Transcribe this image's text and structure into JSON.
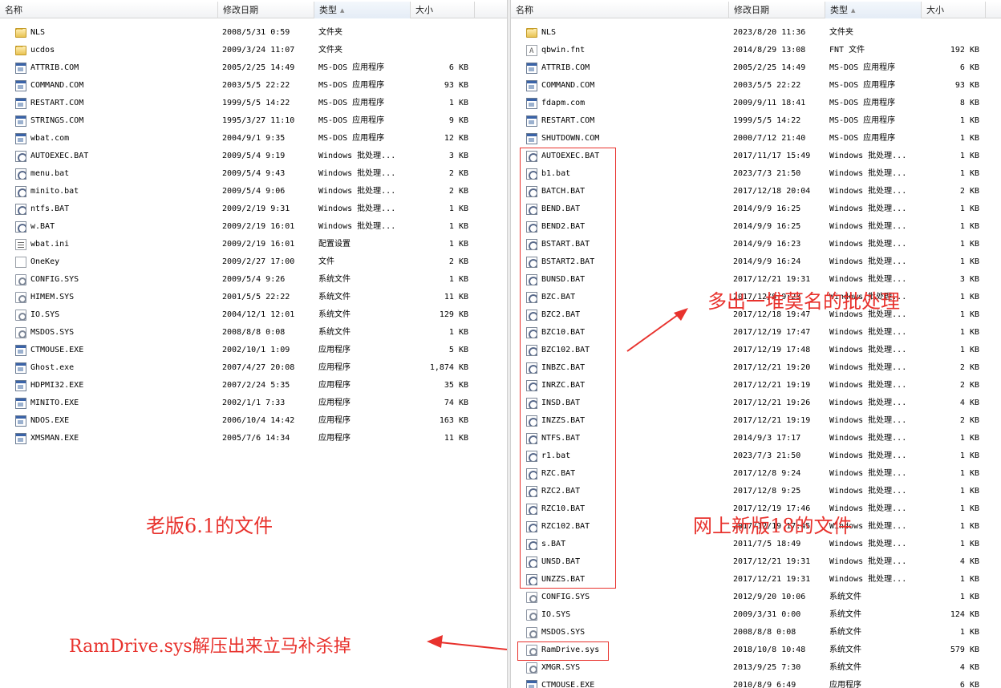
{
  "columns": {
    "name": "名称",
    "date": "修改日期",
    "type": "类型",
    "size": "大小"
  },
  "left": {
    "rows": [
      {
        "icon": "folder",
        "name": "NLS",
        "date": "2008/5/31 0:59",
        "type": "文件夹",
        "size": ""
      },
      {
        "icon": "folder",
        "name": "ucdos",
        "date": "2009/3/24 11:07",
        "type": "文件夹",
        "size": ""
      },
      {
        "icon": "app",
        "name": "ATTRIB.COM",
        "date": "2005/2/25 14:49",
        "type": "MS-DOS 应用程序",
        "size": "6 KB"
      },
      {
        "icon": "app",
        "name": "COMMAND.COM",
        "date": "2003/5/5 22:22",
        "type": "MS-DOS 应用程序",
        "size": "93 KB"
      },
      {
        "icon": "app",
        "name": "RESTART.COM",
        "date": "1999/5/5 14:22",
        "type": "MS-DOS 应用程序",
        "size": "1 KB"
      },
      {
        "icon": "app",
        "name": "STRINGS.COM",
        "date": "1995/3/27 11:10",
        "type": "MS-DOS 应用程序",
        "size": "9 KB"
      },
      {
        "icon": "app",
        "name": "wbat.com",
        "date": "2004/9/1 9:35",
        "type": "MS-DOS 应用程序",
        "size": "12 KB"
      },
      {
        "icon": "bat",
        "name": "AUTOEXEC.BAT",
        "date": "2009/5/4 9:19",
        "type": "Windows 批处理...",
        "size": "3 KB"
      },
      {
        "icon": "bat",
        "name": "menu.bat",
        "date": "2009/5/4 9:43",
        "type": "Windows 批处理...",
        "size": "2 KB"
      },
      {
        "icon": "bat",
        "name": "minito.bat",
        "date": "2009/5/4 9:06",
        "type": "Windows 批处理...",
        "size": "2 KB"
      },
      {
        "icon": "bat",
        "name": "ntfs.BAT",
        "date": "2009/2/19 9:31",
        "type": "Windows 批处理...",
        "size": "1 KB"
      },
      {
        "icon": "bat",
        "name": "w.BAT",
        "date": "2009/2/19 16:01",
        "type": "Windows 批处理...",
        "size": "1 KB"
      },
      {
        "icon": "ini",
        "name": "wbat.ini",
        "date": "2009/2/19 16:01",
        "type": "配置设置",
        "size": "1 KB"
      },
      {
        "icon": "doc",
        "name": "OneKey",
        "date": "2009/2/27 17:00",
        "type": "文件",
        "size": "2 KB"
      },
      {
        "icon": "sys",
        "name": "CONFIG.SYS",
        "date": "2009/5/4 9:26",
        "type": "系统文件",
        "size": "1 KB"
      },
      {
        "icon": "sys",
        "name": "HIMEM.SYS",
        "date": "2001/5/5 22:22",
        "type": "系统文件",
        "size": "11 KB"
      },
      {
        "icon": "sys",
        "name": "IO.SYS",
        "date": "2004/12/1 12:01",
        "type": "系统文件",
        "size": "129 KB"
      },
      {
        "icon": "sys",
        "name": "MSDOS.SYS",
        "date": "2008/8/8 0:08",
        "type": "系统文件",
        "size": "1 KB"
      },
      {
        "icon": "app",
        "name": "CTMOUSE.EXE",
        "date": "2002/10/1 1:09",
        "type": "应用程序",
        "size": "5 KB"
      },
      {
        "icon": "app",
        "name": "Ghost.exe",
        "date": "2007/4/27 20:08",
        "type": "应用程序",
        "size": "1,874 KB"
      },
      {
        "icon": "app",
        "name": "HDPMI32.EXE",
        "date": "2007/2/24 5:35",
        "type": "应用程序",
        "size": "35 KB"
      },
      {
        "icon": "app",
        "name": "MINITO.EXE",
        "date": "2002/1/1 7:33",
        "type": "应用程序",
        "size": "74 KB"
      },
      {
        "icon": "app",
        "name": "NDOS.EXE",
        "date": "2006/10/4 14:42",
        "type": "应用程序",
        "size": "163 KB"
      },
      {
        "icon": "app",
        "name": "XMSMAN.EXE",
        "date": "2005/7/6 14:34",
        "type": "应用程序",
        "size": "11 KB"
      }
    ]
  },
  "right": {
    "rows": [
      {
        "icon": "folder",
        "name": "NLS",
        "date": "2023/8/20 11:36",
        "type": "文件夹",
        "size": ""
      },
      {
        "icon": "fnt",
        "name": "qbwin.fnt",
        "date": "2014/8/29 13:08",
        "type": "FNT 文件",
        "size": "192 KB"
      },
      {
        "icon": "app",
        "name": "ATTRIB.COM",
        "date": "2005/2/25 14:49",
        "type": "MS-DOS 应用程序",
        "size": "6 KB"
      },
      {
        "icon": "app",
        "name": "COMMAND.COM",
        "date": "2003/5/5 22:22",
        "type": "MS-DOS 应用程序",
        "size": "93 KB"
      },
      {
        "icon": "app",
        "name": "fdapm.com",
        "date": "2009/9/11 18:41",
        "type": "MS-DOS 应用程序",
        "size": "8 KB"
      },
      {
        "icon": "app",
        "name": "RESTART.COM",
        "date": "1999/5/5 14:22",
        "type": "MS-DOS 应用程序",
        "size": "1 KB"
      },
      {
        "icon": "app",
        "name": "SHUTDOWN.COM",
        "date": "2000/7/12 21:40",
        "type": "MS-DOS 应用程序",
        "size": "1 KB"
      },
      {
        "icon": "bat",
        "name": "AUTOEXEC.BAT",
        "date": "2017/11/17 15:49",
        "type": "Windows 批处理...",
        "size": "1 KB"
      },
      {
        "icon": "bat",
        "name": "b1.bat",
        "date": "2023/7/3 21:50",
        "type": "Windows 批处理...",
        "size": "1 KB"
      },
      {
        "icon": "bat",
        "name": "BATCH.BAT",
        "date": "2017/12/18 20:04",
        "type": "Windows 批处理...",
        "size": "2 KB"
      },
      {
        "icon": "bat",
        "name": "BEND.BAT",
        "date": "2014/9/9 16:25",
        "type": "Windows 批处理...",
        "size": "1 KB"
      },
      {
        "icon": "bat",
        "name": "BEND2.BAT",
        "date": "2014/9/9 16:25",
        "type": "Windows 批处理...",
        "size": "1 KB"
      },
      {
        "icon": "bat",
        "name": "BSTART.BAT",
        "date": "2014/9/9 16:23",
        "type": "Windows 批处理...",
        "size": "1 KB"
      },
      {
        "icon": "bat",
        "name": "BSTART2.BAT",
        "date": "2014/9/9 16:24",
        "type": "Windows 批处理...",
        "size": "1 KB"
      },
      {
        "icon": "bat",
        "name": "BUNSD.BAT",
        "date": "2017/12/21 19:31",
        "type": "Windows 批处理...",
        "size": "3 KB"
      },
      {
        "icon": "bat",
        "name": "BZC.BAT",
        "date": "2017/12/8 9:23",
        "type": "Windows 批处理...",
        "size": "1 KB"
      },
      {
        "icon": "bat",
        "name": "BZC2.BAT",
        "date": "2017/12/18 19:47",
        "type": "Windows 批处理...",
        "size": "1 KB"
      },
      {
        "icon": "bat",
        "name": "BZC10.BAT",
        "date": "2017/12/19 17:47",
        "type": "Windows 批处理...",
        "size": "1 KB"
      },
      {
        "icon": "bat",
        "name": "BZC102.BAT",
        "date": "2017/12/19 17:48",
        "type": "Windows 批处理...",
        "size": "1 KB"
      },
      {
        "icon": "bat",
        "name": "INBZC.BAT",
        "date": "2017/12/21 19:20",
        "type": "Windows 批处理...",
        "size": "2 KB"
      },
      {
        "icon": "bat",
        "name": "INRZC.BAT",
        "date": "2017/12/21 19:19",
        "type": "Windows 批处理...",
        "size": "2 KB"
      },
      {
        "icon": "bat",
        "name": "INSD.BAT",
        "date": "2017/12/21 19:26",
        "type": "Windows 批处理...",
        "size": "4 KB"
      },
      {
        "icon": "bat",
        "name": "INZZS.BAT",
        "date": "2017/12/21 19:19",
        "type": "Windows 批处理...",
        "size": "2 KB"
      },
      {
        "icon": "bat",
        "name": "NTFS.BAT",
        "date": "2014/9/3 17:17",
        "type": "Windows 批处理...",
        "size": "1 KB"
      },
      {
        "icon": "bat",
        "name": "r1.bat",
        "date": "2023/7/3 21:50",
        "type": "Windows 批处理...",
        "size": "1 KB"
      },
      {
        "icon": "bat",
        "name": "RZC.BAT",
        "date": "2017/12/8 9:24",
        "type": "Windows 批处理...",
        "size": "1 KB"
      },
      {
        "icon": "bat",
        "name": "RZC2.BAT",
        "date": "2017/12/8 9:25",
        "type": "Windows 批处理...",
        "size": "1 KB"
      },
      {
        "icon": "bat",
        "name": "RZC10.BAT",
        "date": "2017/12/19 17:46",
        "type": "Windows 批处理...",
        "size": "1 KB"
      },
      {
        "icon": "bat",
        "name": "RZC102.BAT",
        "date": "2017/12/19 17:45",
        "type": "Windows 批处理...",
        "size": "1 KB"
      },
      {
        "icon": "bat",
        "name": "s.BAT",
        "date": "2011/7/5 18:49",
        "type": "Windows 批处理...",
        "size": "1 KB"
      },
      {
        "icon": "bat",
        "name": "UNSD.BAT",
        "date": "2017/12/21 19:31",
        "type": "Windows 批处理...",
        "size": "4 KB"
      },
      {
        "icon": "bat",
        "name": "UNZZS.BAT",
        "date": "2017/12/21 19:31",
        "type": "Windows 批处理...",
        "size": "1 KB"
      },
      {
        "icon": "sys",
        "name": "CONFIG.SYS",
        "date": "2012/9/20 10:06",
        "type": "系统文件",
        "size": "1 KB"
      },
      {
        "icon": "sys",
        "name": "IO.SYS",
        "date": "2009/3/31 0:00",
        "type": "系统文件",
        "size": "124 KB"
      },
      {
        "icon": "sys",
        "name": "MSDOS.SYS",
        "date": "2008/8/8 0:08",
        "type": "系统文件",
        "size": "1 KB"
      },
      {
        "icon": "sys",
        "name": "RamDrive.sys",
        "date": "2018/10/8 10:48",
        "type": "系统文件",
        "size": "579 KB"
      },
      {
        "icon": "sys",
        "name": "XMGR.SYS",
        "date": "2013/9/25 7:30",
        "type": "系统文件",
        "size": "4 KB"
      },
      {
        "icon": "app",
        "name": "CTMOUSE.EXE",
        "date": "2010/8/9 6:49",
        "type": "应用程序",
        "size": "6 KB"
      }
    ]
  },
  "annotations": {
    "old_label": "老版6.1的文件",
    "new_label": "网上新版18的文件",
    "extra_batch_label": "多出一堆莫名的批处理",
    "ramdrive_label": "RamDrive.sys解压出来立马补杀掉"
  },
  "colors": {
    "annotation": "#e8322d",
    "header_sorted": "#e4ecf6",
    "row_text": "#000000"
  }
}
